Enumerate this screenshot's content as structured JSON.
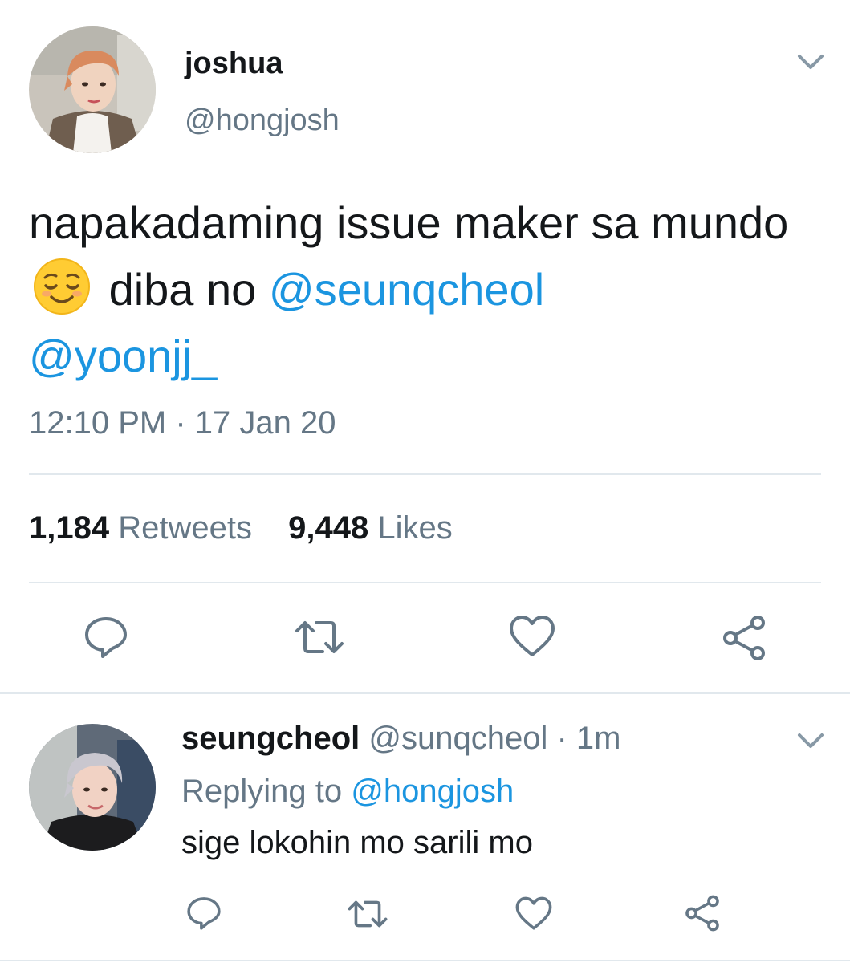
{
  "main_tweet": {
    "display_name": "joshua",
    "handle": "@hongjosh",
    "text_part1": "napakadaming issue maker sa mundo",
    "emoji": "relieved-face-emoji",
    "text_part2": "diba no",
    "mention1": "@seunqcheol",
    "mention2": "@yoonjj_",
    "timestamp": "12:10 PM · 17 Jan 20",
    "retweet_count": "1,184",
    "retweet_label": "Retweets",
    "like_count": "9,448",
    "like_label": "Likes",
    "actions": [
      "reply-icon",
      "retweet-icon",
      "like-icon",
      "share-icon"
    ]
  },
  "reply": {
    "display_name": "seungcheol",
    "handle": "@sunqcheol",
    "time": "· 1m",
    "replying_label": "Replying to",
    "replying_handle": "@hongjosh",
    "text": "sige lokohin mo sarili mo",
    "actions": [
      "reply-icon",
      "retweet-icon",
      "like-icon",
      "share-icon"
    ]
  },
  "colors": {
    "text": "#14171a",
    "secondary": "#657786",
    "link": "#1b95e0",
    "divider": "#e1e8ed"
  }
}
